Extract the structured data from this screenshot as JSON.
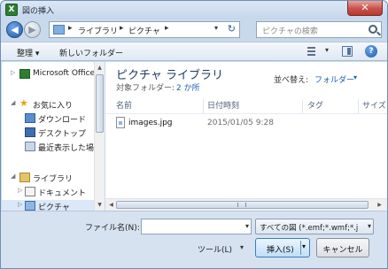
{
  "window": {
    "title": "図の挿入",
    "app_icon_glyph": "X",
    "close_glyph": "✕"
  },
  "address": {
    "crumbs": [
      "ライブラリ",
      "ピクチャ"
    ],
    "separator": "▸",
    "dropdown_glyph": "▾",
    "refresh_glyph": "↻"
  },
  "search": {
    "placeholder": "ピクチャの検索"
  },
  "toolbar": {
    "organize_label": "整理 ▾",
    "new_folder_label": "新しいフォルダー",
    "help_glyph": "?"
  },
  "nav": {
    "items": [
      {
        "label": "Microsoft Office E",
        "icon": "office-icon",
        "expander": "▷"
      },
      {
        "label": "お気に入り",
        "icon": "star-icon",
        "expander": "◢"
      },
      {
        "label": "ダウンロード",
        "icon": "download-folder-icon"
      },
      {
        "label": "デスクトップ",
        "icon": "desktop-icon"
      },
      {
        "label": "最近表示した場所",
        "icon": "recent-places-icon"
      },
      {
        "label": "ライブラリ",
        "icon": "library-icon",
        "expander": "◢"
      },
      {
        "label": "ドキュメント",
        "icon": "documents-icon",
        "expander": "▷"
      },
      {
        "label": "ピクチャ",
        "icon": "pictures-icon",
        "expander": "▷"
      }
    ]
  },
  "content": {
    "library_title": "ピクチャ ライブラリ",
    "target_label": "対象フォルダー:",
    "target_link": "2 か所",
    "arrange_label": "並べ替え:",
    "arrange_value": "フォルダー",
    "arrange_dd": "▾",
    "columns": [
      "名前",
      "日付時刻",
      "タグ",
      "サイズ"
    ],
    "files": [
      {
        "name": "images.jpg",
        "date": "2015/01/05 9:28"
      }
    ]
  },
  "bottom": {
    "filename_label": "ファイル名(N):",
    "filename_value": "",
    "file_type": "すべての図 (*.emf;*.wmf;*.j",
    "tools_label": "ツール(L)",
    "insert_label": "挿入(S)",
    "cancel_label": "キャンセル",
    "dd_glyph": "▾"
  },
  "colors": {
    "accent": "#1a5fb4",
    "title_close": "#c75050",
    "library_title": "#1e395b"
  }
}
